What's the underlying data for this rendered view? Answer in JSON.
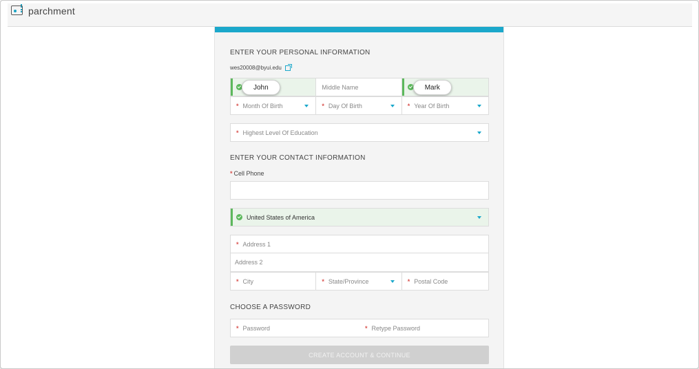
{
  "brand": {
    "name": "parchment"
  },
  "personal": {
    "heading": "ENTER YOUR PERSONAL INFORMATION",
    "email": "wes20008@byui.edu",
    "first_name": "John",
    "middle_name_placeholder": "Middle Name",
    "last_name": "Mark",
    "month_placeholder": "Month Of Birth",
    "day_placeholder": "Day Of Birth",
    "year_placeholder": "Year Of Birth",
    "education_placeholder": "Highest Level Of Education"
  },
  "contact": {
    "heading": "ENTER YOUR CONTACT INFORMATION",
    "cell_phone_label": "Cell Phone",
    "cell_phone_value": "",
    "country": "United States of America",
    "address1_placeholder": "Address 1",
    "address2_placeholder": "Address 2",
    "city_placeholder": "City",
    "state_placeholder": "State/Province",
    "postal_placeholder": "Postal Code"
  },
  "password": {
    "heading": "CHOOSE A PASSWORD",
    "password_placeholder": "Password",
    "retype_placeholder": "Retype Password"
  },
  "submit": {
    "label": "CREATE ACCOUNT & CONTINUE"
  },
  "required_marker": "*",
  "colors": {
    "accent": "#1ba8cb",
    "valid": "#5cb85c",
    "required": "#d9534f",
    "button_disabled": "#d0d0d0"
  },
  "icons": {
    "valid": "check-circle-icon",
    "dropdown": "caret-down-icon",
    "email_edit": "external-link-icon"
  }
}
